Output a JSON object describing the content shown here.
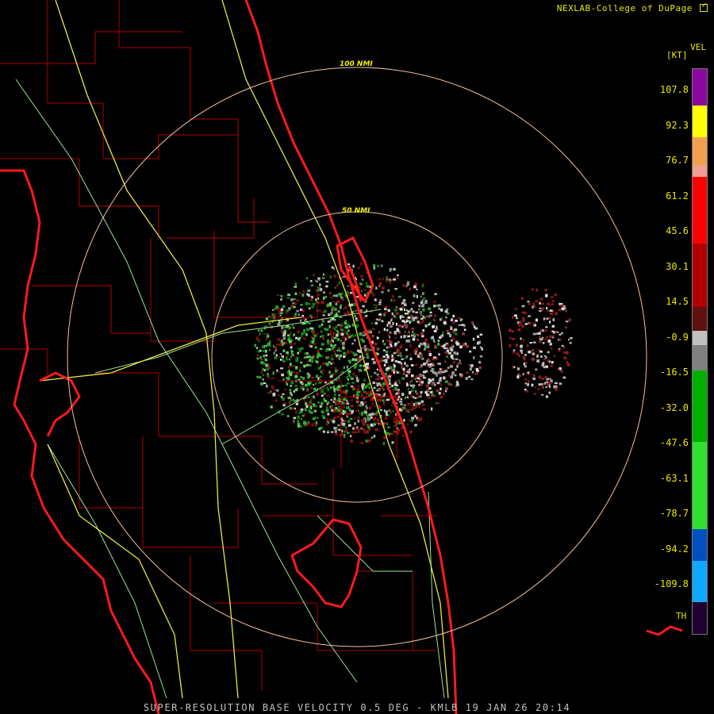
{
  "header": {
    "credit": "NEXLAB-College of DuPage",
    "credit_icon": "external-link-icon"
  },
  "product": {
    "code": "VEL",
    "unit": "[KT]"
  },
  "rings": [
    {
      "label": "100 NMI"
    },
    {
      "label": "50 NMI"
    }
  ],
  "legend": {
    "labels": [
      "107.8",
      "92.3",
      "76.7",
      "61.2",
      "45.6",
      "30.1",
      "14.5",
      "-0.9",
      "-16.5",
      "-32.0",
      "-47.6",
      "-63.1",
      "-78.7",
      "-94.2",
      "-109.8"
    ],
    "th_label": "TH",
    "colors": [
      "#8a0aa0",
      "#ffff00",
      "#f2a050",
      "#ff0000",
      "#b00000",
      "#601010",
      "#c0c0c0",
      "#808080",
      "#00b000",
      "#30e030",
      "#0050c0",
      "#10a8ff",
      "#200030"
    ]
  },
  "footer": {
    "text": "SUPER-RESOLUTION BASE VELOCITY 0.5 DEG - KMLB 19 JAN 26 20:14"
  }
}
